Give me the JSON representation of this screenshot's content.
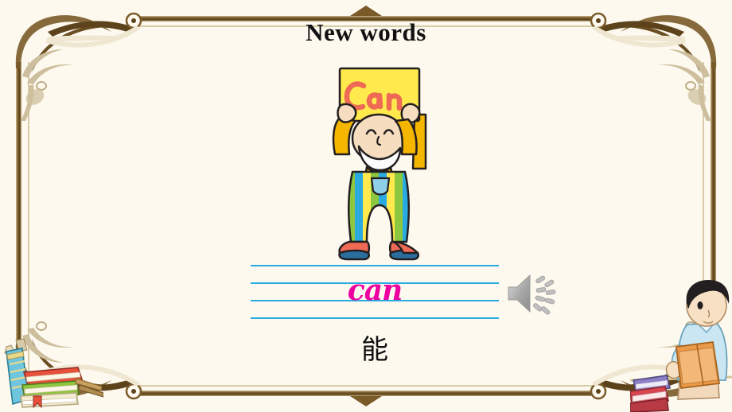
{
  "slide": {
    "title": "New words",
    "background_color": "#fdf9ef",
    "frame_color": "#7a5a28",
    "frame_color_light": "#c9bda0"
  },
  "illustration": {
    "name": "cartoon-man-holding-sign",
    "sign_text": "Can",
    "sign_color": "#ffe94d",
    "sign_text_color": "#ef6a55",
    "skin_color": "#f6ddc0",
    "beard_color": "#fbfbfb",
    "sleeve_color": "#f5b600",
    "shoe_top_color": "#ef6a55",
    "shoe_sole_color": "#2a6d9e",
    "overall_stripe_colors": [
      "#7cc242",
      "#29abe2",
      "#ffe94d",
      "#8dc63f",
      "#f5b600"
    ]
  },
  "writing": {
    "word": "can",
    "word_color": "#ed00a0",
    "line_color": "#29abe2",
    "line_count": 4
  },
  "audio": {
    "icon": "speaker-icon",
    "color": "#a6a6a6",
    "label": "Play pronunciation"
  },
  "meaning": {
    "text": "能"
  },
  "decorations": {
    "bottom_left": {
      "name": "stack-of-books-and-pencil-case",
      "book_colors": [
        "#e03c31",
        "#8dc63f",
        "#f2e6c9",
        "#29abe2"
      ]
    },
    "bottom_right": {
      "name": "boy-reading-book",
      "shirt_color": "#bfe2f0",
      "book_color": "#eb8f3a",
      "hair_color": "#1f1a17",
      "stacked_book_colors": [
        "#8a7fc4",
        "#d64550"
      ]
    },
    "top_center_ornament": "diamond-peak",
    "bottom_center_ornament": "diamond-peak-inverted"
  }
}
